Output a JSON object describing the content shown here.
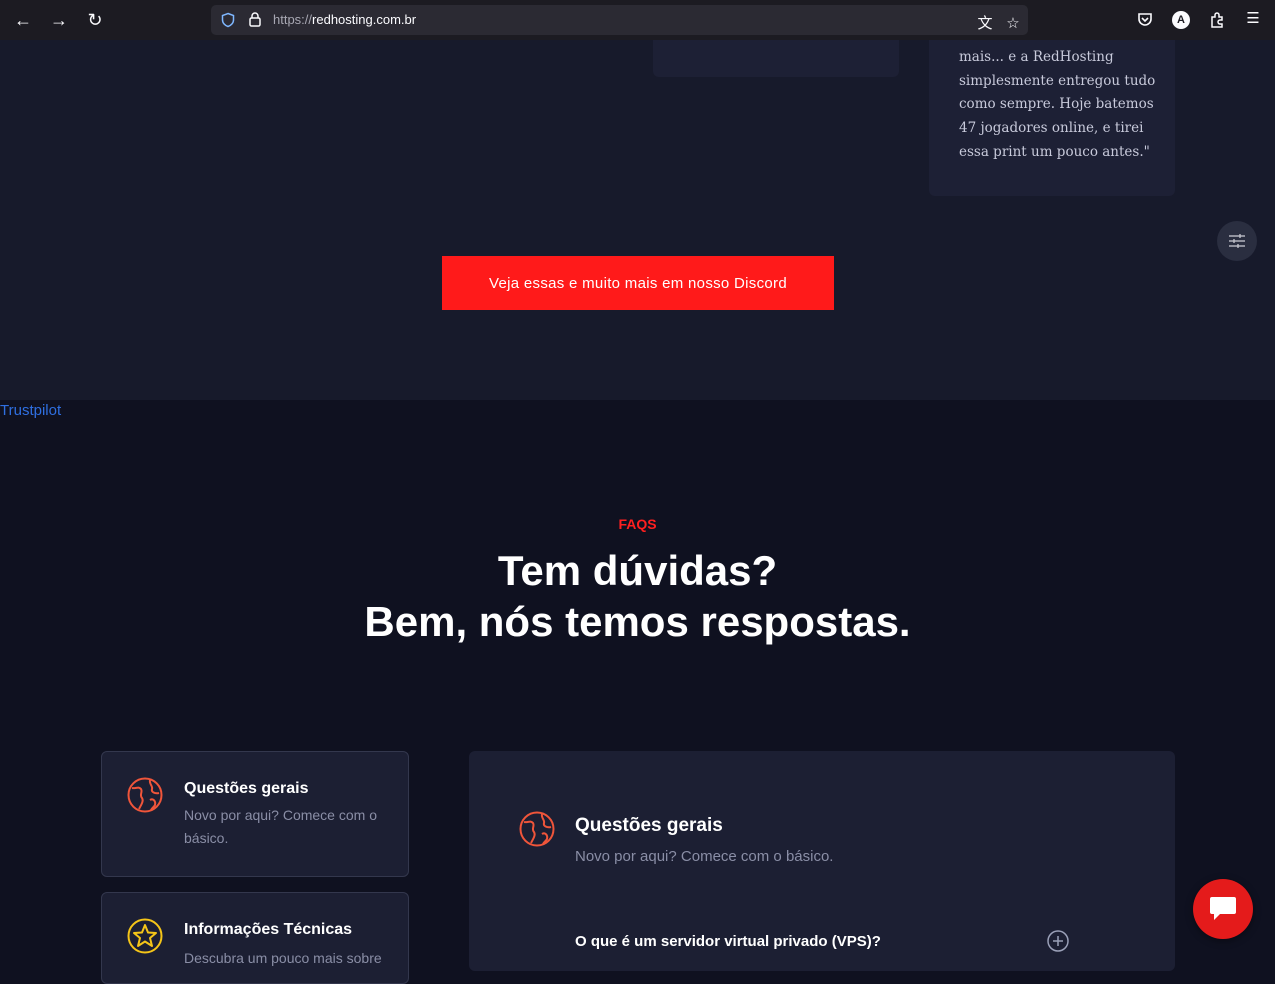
{
  "browser": {
    "url_scheme": "https://",
    "url_host": "redhosting.com.br"
  },
  "testimonial": {
    "text": "mais... e a RedHosting simplesmente entregou tudo como sempre. Hoje batemos 47 jogadores online, e tirei essa print um pouco antes.\""
  },
  "discord_button": {
    "label": "Veja essas e muito mais em nosso Discord"
  },
  "trustpilot": {
    "label": "Trustpilot"
  },
  "faq": {
    "eyebrow": "FAQS",
    "title_line1": "Tem dúvidas?",
    "title_line2": "Bem, nós temos respostas.",
    "categories": [
      {
        "title": "Questões gerais",
        "desc": "Novo por aqui? Comece com o básico.",
        "icon": "globe-icon"
      },
      {
        "title": "Informações Técnicas",
        "desc": "Descubra um pouco mais sobre",
        "icon": "star-icon"
      }
    ],
    "panel": {
      "title": "Questões gerais",
      "desc": "Novo por aqui? Comece com o básico.",
      "question": "O que é um servidor virtual privado (VPS)?"
    }
  },
  "colors": {
    "accent": "#ff1a1a",
    "icon_globe": "#f0553a",
    "icon_star": "#f5c518"
  }
}
